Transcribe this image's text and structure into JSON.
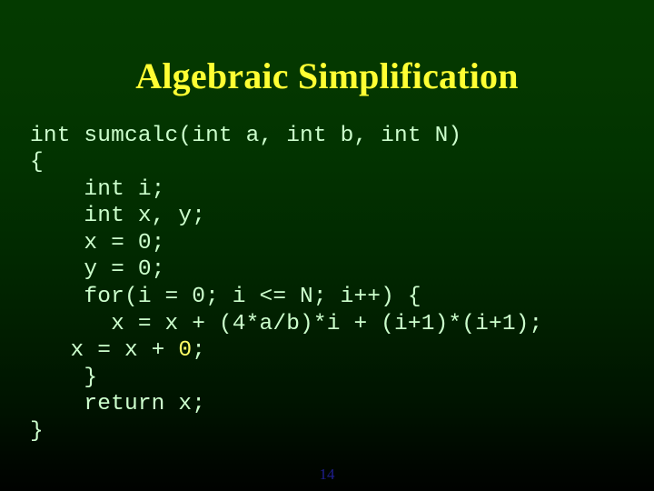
{
  "slide": {
    "title": "Algebraic Simplification",
    "page_number": "14",
    "colors": {
      "background_top": "#043a00",
      "background_bottom": "#000200",
      "title_text": "#ffff33",
      "code_text": "#ccffcc",
      "code_highlight": "#ffff66",
      "page_number_text": "#1f1f8f"
    }
  },
  "code": {
    "language": "c",
    "lines": [
      {
        "text": "int sumcalc(int a, int b, int N)",
        "highlight": null
      },
      {
        "text": "{",
        "highlight": null
      },
      {
        "text": "    int i;",
        "highlight": null
      },
      {
        "text": "    int x, y;",
        "highlight": null
      },
      {
        "text": "    x = 0;",
        "highlight": null
      },
      {
        "text": "    y = 0;",
        "highlight": null
      },
      {
        "text": "    for(i = 0; i <= N; i++) {",
        "highlight": null
      },
      {
        "text": "      x = x + (4*a/b)*i + (i+1)*(i+1);",
        "highlight": null
      },
      {
        "text": "   x = x + ",
        "highlight": "0",
        "text_after": ";"
      },
      {
        "text": "    }",
        "highlight": null
      },
      {
        "text": "    return x;",
        "highlight": null
      },
      {
        "text": "}",
        "highlight": null
      }
    ]
  }
}
